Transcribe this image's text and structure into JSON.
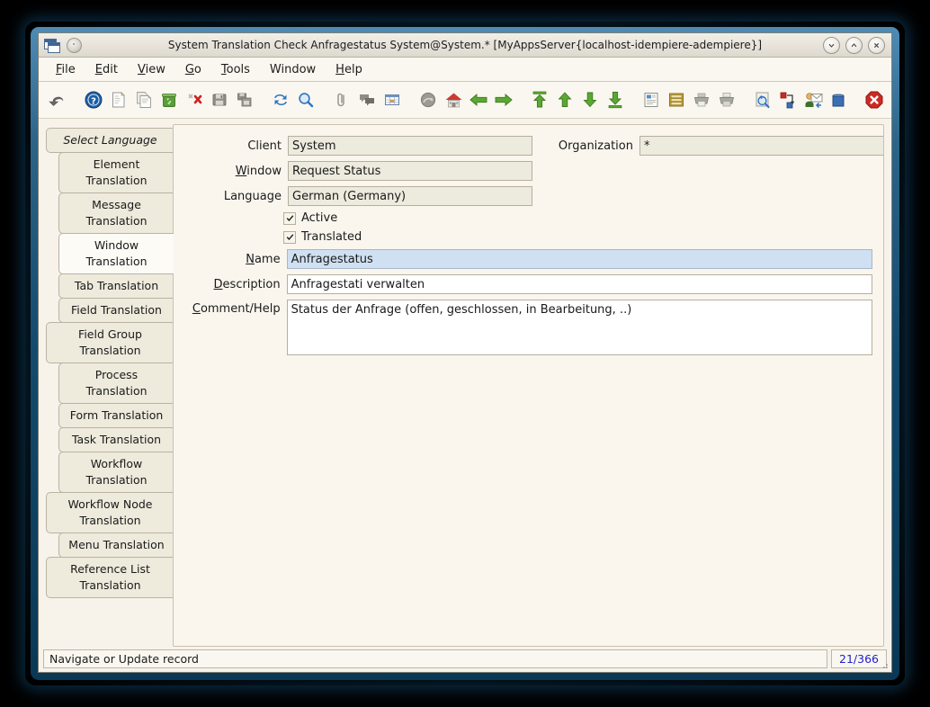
{
  "window": {
    "title": "System Translation Check  Anfragestatus  System@System.* [MyAppsServer{localhost-idempiere-adempiere}]",
    "icon_left": "windows-stack-icon",
    "icon_disc": "disc-icon",
    "buttons": {
      "minimize": "minimize-button",
      "maximize": "maximize-button",
      "close": "close-button"
    }
  },
  "menubar": {
    "items": [
      {
        "label": "File",
        "mnemonic": "F"
      },
      {
        "label": "Edit",
        "mnemonic": "E"
      },
      {
        "label": "View",
        "mnemonic": "V"
      },
      {
        "label": "Go",
        "mnemonic": "G"
      },
      {
        "label": "Tools",
        "mnemonic": "T"
      },
      {
        "label": "Window",
        "mnemonic": ""
      },
      {
        "label": "Help",
        "mnemonic": "H"
      }
    ]
  },
  "toolbar": {
    "items": [
      "undo-icon",
      "help-icon",
      "new-record-icon",
      "copy-record-icon",
      "delete-record-icon",
      "delete-selection-icon",
      "save-icon",
      "save-create-icon",
      "refresh-icon",
      "find-icon",
      "attachment-icon",
      "chat-icon",
      "grid-toggle-icon",
      "history-icon",
      "home-icon",
      "back-arrow-icon",
      "forward-arrow-icon",
      "first-record-icon",
      "previous-record-icon",
      "next-record-icon",
      "last-record-icon",
      "report-icon",
      "archive-icon",
      "print-preview-icon",
      "print-icon",
      "zoom-across-icon",
      "active-workflow-icon",
      "request-icon",
      "product-info-icon",
      "exit-icon"
    ]
  },
  "tabs": [
    {
      "label": "Select Language",
      "style": "italic",
      "wide": true,
      "selected": false
    },
    {
      "label": "Element Translation",
      "style": "normal",
      "wide": false,
      "selected": false
    },
    {
      "label": "Message Translation",
      "style": "normal",
      "wide": false,
      "selected": false
    },
    {
      "label": "Window Translation",
      "style": "normal",
      "wide": false,
      "selected": true
    },
    {
      "label": "Tab Translation",
      "style": "normal",
      "wide": false,
      "selected": false
    },
    {
      "label": "Field Translation",
      "style": "normal",
      "wide": false,
      "selected": false
    },
    {
      "label": "Field Group Translation",
      "style": "normal",
      "wide": true,
      "selected": false
    },
    {
      "label": "Process Translation",
      "style": "normal",
      "wide": false,
      "selected": false
    },
    {
      "label": "Form Translation",
      "style": "normal",
      "wide": false,
      "selected": false
    },
    {
      "label": "Task Translation",
      "style": "normal",
      "wide": false,
      "selected": false
    },
    {
      "label": "Workflow Translation",
      "style": "normal",
      "wide": false,
      "selected": false
    },
    {
      "label": "Workflow Node Translation",
      "style": "normal",
      "wide": true,
      "selected": false
    },
    {
      "label": "Menu Translation",
      "style": "normal",
      "wide": false,
      "selected": false
    },
    {
      "label": "Reference List Translation",
      "style": "normal",
      "wide": true,
      "selected": false
    }
  ],
  "form": {
    "client": {
      "label": "Client",
      "value": "System"
    },
    "organization": {
      "label": "Organization",
      "value": "*"
    },
    "window": {
      "label": "Window",
      "mnemonic": "W",
      "value": "Request Status"
    },
    "language": {
      "label": "Language",
      "value": "German (Germany)"
    },
    "active": {
      "label": "Active",
      "checked": true
    },
    "translated": {
      "label": "Translated",
      "checked": true
    },
    "name": {
      "label": "Name",
      "mnemonic": "N",
      "value": "Anfragestatus",
      "focused": true
    },
    "description": {
      "label": "Description",
      "mnemonic": "D",
      "value": "Anfragestati verwalten"
    },
    "comment": {
      "label": "Comment/Help",
      "mnemonic": "C",
      "value": "Status der Anfrage (offen, geschlossen, in Bearbeitung, ..)"
    }
  },
  "statusbar": {
    "message": "Navigate or Update record",
    "record_count": "21/366"
  },
  "colors": {
    "panel": "#faf6ee",
    "field": "#edeade",
    "field_focus": "#cfe0f2",
    "tab": "#eeeadc",
    "tab_selected": "#fdfbf6",
    "count_text": "#2222cc",
    "frame": "#124a6d"
  }
}
